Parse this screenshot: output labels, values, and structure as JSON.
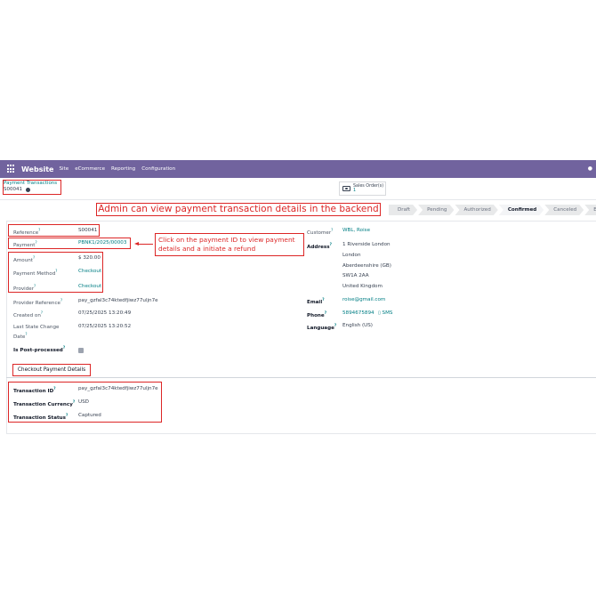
{
  "navbar": {
    "brand": "Website",
    "menu": [
      "Site",
      "eCommerce",
      "Reporting",
      "Configuration"
    ]
  },
  "breadcrumb": {
    "parent": "Payment Transactions",
    "current": "S00041"
  },
  "smart_button": {
    "label": "Sales Order(s)",
    "count": "1"
  },
  "annotations": {
    "top": "Admin can view payment transaction details in the backend",
    "payment_note": "Click on the payment ID to view payment details and a initiate a refund"
  },
  "statusbar": {
    "stages": [
      "Draft",
      "Pending",
      "Authorized",
      "Confirmed",
      "Canceled",
      "Error"
    ],
    "active": "Confirmed"
  },
  "form": {
    "reference_label": "Reference",
    "reference": "S00041",
    "payment_label": "Payment",
    "payment": "PBNK1/2025/00003",
    "amount_label": "Amount",
    "amount": "$ 320.00",
    "payment_method_label": "Payment Method",
    "payment_method": "Checkout",
    "provider_label": "Provider",
    "provider": "Checkout",
    "provider_reference_label": "Provider Reference",
    "provider_reference": "pay_gzfal3c74ktedfjiwz77uljn7e",
    "created_on_label": "Created on",
    "created_on": "07/25/2025 13:20:49",
    "last_state_change_label": "Last State Change Date",
    "last_state_change": "07/25/2025 13:20:52",
    "is_post_processed_label": "Is Post-processed",
    "customer_label": "Customer",
    "customer": "WBL, Roise",
    "address_label": "Address",
    "address_lines": [
      "1 Riverside London",
      "London",
      "Aberdeenshire (GB)",
      "SW1A 2AA",
      "United Kingdom"
    ],
    "email_label": "Email",
    "email": "roise@gmail.com",
    "phone_label": "Phone",
    "phone": "5894675894",
    "sms": "SMS",
    "language_label": "Language",
    "language": "English (US)"
  },
  "tab": {
    "label": "Checkout Payment Details"
  },
  "checkout_details": {
    "transaction_id_label": "Transaction ID",
    "transaction_id": "pay_gzfal3c74ktedfjiwz77uljn7e",
    "transaction_currency_label": "Transaction Currency",
    "transaction_currency": "USD",
    "transaction_status_label": "Transaction Status",
    "transaction_status": "Captured"
  },
  "colors": {
    "navbar": "#71639e",
    "link": "#017e84",
    "annotation": "#dc2626"
  }
}
